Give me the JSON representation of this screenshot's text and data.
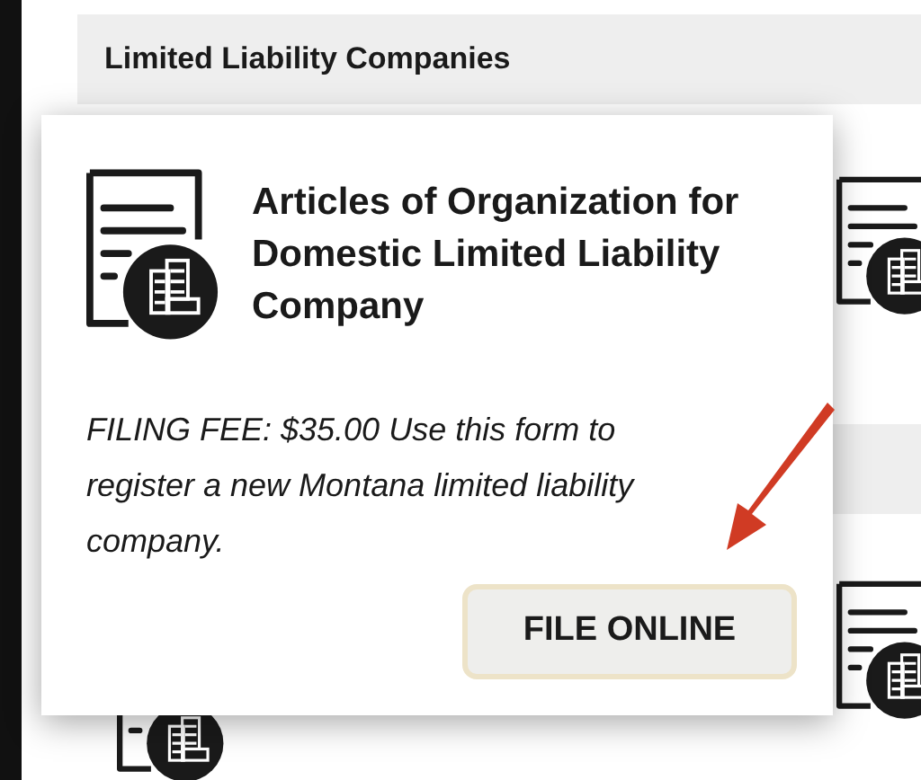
{
  "section": {
    "title": "Limited Liability Companies"
  },
  "card": {
    "title": "Articles of Organization for Domestic Limited Liability Company",
    "description": "FILING FEE: $35.00 Use this form to register a new Montana limited liability company.",
    "button": "FILE ONLINE"
  }
}
